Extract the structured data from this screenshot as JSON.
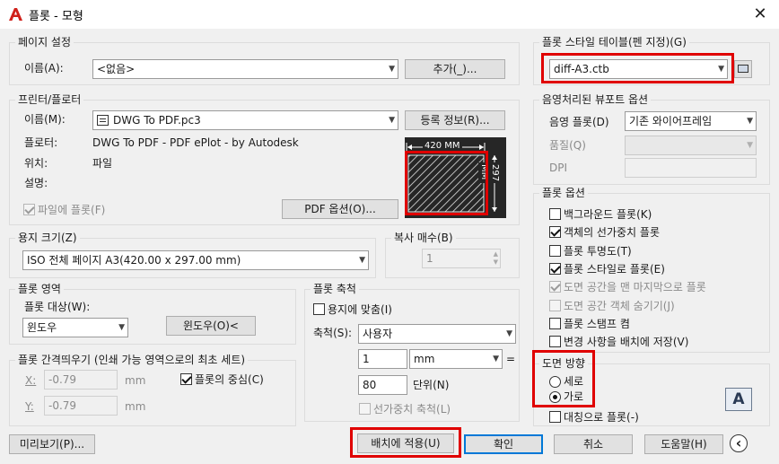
{
  "window": {
    "title": "플롯 - 모형",
    "close_glyph": "✕"
  },
  "page_setup": {
    "group_title": "페이지 설정",
    "name_label": "이름(A):",
    "name_value": "<없음>",
    "add_button": "추가(_)..."
  },
  "printer": {
    "group_title": "프린터/플로터",
    "name_label": "이름(M):",
    "name_value": "DWG To PDF.pc3",
    "properties_button": "등록 정보(R)...",
    "plotter_label": "플로터:",
    "plotter_value": "DWG To PDF - PDF ePlot - by Autodesk",
    "location_label": "위치:",
    "location_value": "파일",
    "description_label": "설명:",
    "plot_to_file_label": "파일에 플롯(F)",
    "plot_to_file_checked": true,
    "pdf_options_button": "PDF 옵션(O)...",
    "preview_width": "420 MM",
    "preview_height": "297 MM"
  },
  "paper_size": {
    "group_title": "용지 크기(Z)",
    "value": "ISO 전체 페이지 A3(420.00 x 297.00 mm)"
  },
  "copies": {
    "group_title": "복사 매수(B)",
    "value": "1"
  },
  "plot_area": {
    "group_title": "플롯 영역",
    "what_label": "플롯 대상(W):",
    "what_value": "윈도우",
    "window_button": "윈도우(O)<"
  },
  "plot_offset": {
    "group_title": "플롯 간격띄우기 (인쇄 가능 영역으로의 최초 세트)",
    "x_label": "X:",
    "x_value": "-0.79",
    "x_unit": "mm",
    "y_label": "Y:",
    "y_value": "-0.79",
    "y_unit": "mm",
    "center_label": "플롯의 중심(C)",
    "center_checked": true
  },
  "plot_scale": {
    "group_title": "플롯 축척",
    "fit_label": "용지에 맞춤(I)",
    "fit_checked": false,
    "scale_label": "축척(S):",
    "scale_value": "사용자",
    "value1": "1",
    "unit_value": "mm",
    "equals": "=",
    "value2": "80",
    "units_label": "단위(N)",
    "lineweights_label": "선가중치 축척(L)"
  },
  "plot_style_table": {
    "group_title": "플롯 스타일 테이블(펜 지정)(G)",
    "value": "diff-A3.ctb"
  },
  "shaded_viewport": {
    "group_title": "음영처리된 뷰포트 옵션",
    "shade_label": "음영 플롯(D)",
    "shade_value": "기존 와이어프레임",
    "quality_label": "품질(Q)",
    "dpi_label": "DPI"
  },
  "plot_options": {
    "group_title": "플롯 옵션",
    "items": [
      {
        "label": "백그라운드 플롯(K)",
        "checked": false,
        "enabled": true
      },
      {
        "label": "객체의 선가중치 플롯",
        "checked": true,
        "enabled": true
      },
      {
        "label": "플롯 투명도(T)",
        "checked": false,
        "enabled": true
      },
      {
        "label": "플롯 스타일로 플롯(E)",
        "checked": true,
        "enabled": true
      },
      {
        "label": "도면 공간을 맨 마지막으로 플롯",
        "checked": true,
        "enabled": false
      },
      {
        "label": "도면 공간 객체 숨기기(J)",
        "checked": false,
        "enabled": false
      },
      {
        "label": "플롯 스탬프 켬",
        "checked": false,
        "enabled": true
      },
      {
        "label": "변경 사항을 배치에 저장(V)",
        "checked": false,
        "enabled": true
      }
    ]
  },
  "orientation": {
    "group_title": "도면 방향",
    "portrait_label": "세로",
    "landscape_label": "가로",
    "selected": "landscape",
    "upside_down_label": "대칭으로 플롯(-)",
    "preview_glyph": "A"
  },
  "footer": {
    "preview_button": "미리보기(P)...",
    "apply_button": "배치에 적용(U)",
    "ok_button": "확인",
    "cancel_button": "취소",
    "help_button": "도움말(H)",
    "collapse_glyph": "‹"
  },
  "colors": {
    "highlight": "#e00000",
    "focus": "#0078d7",
    "app_red": "#d0201a"
  }
}
